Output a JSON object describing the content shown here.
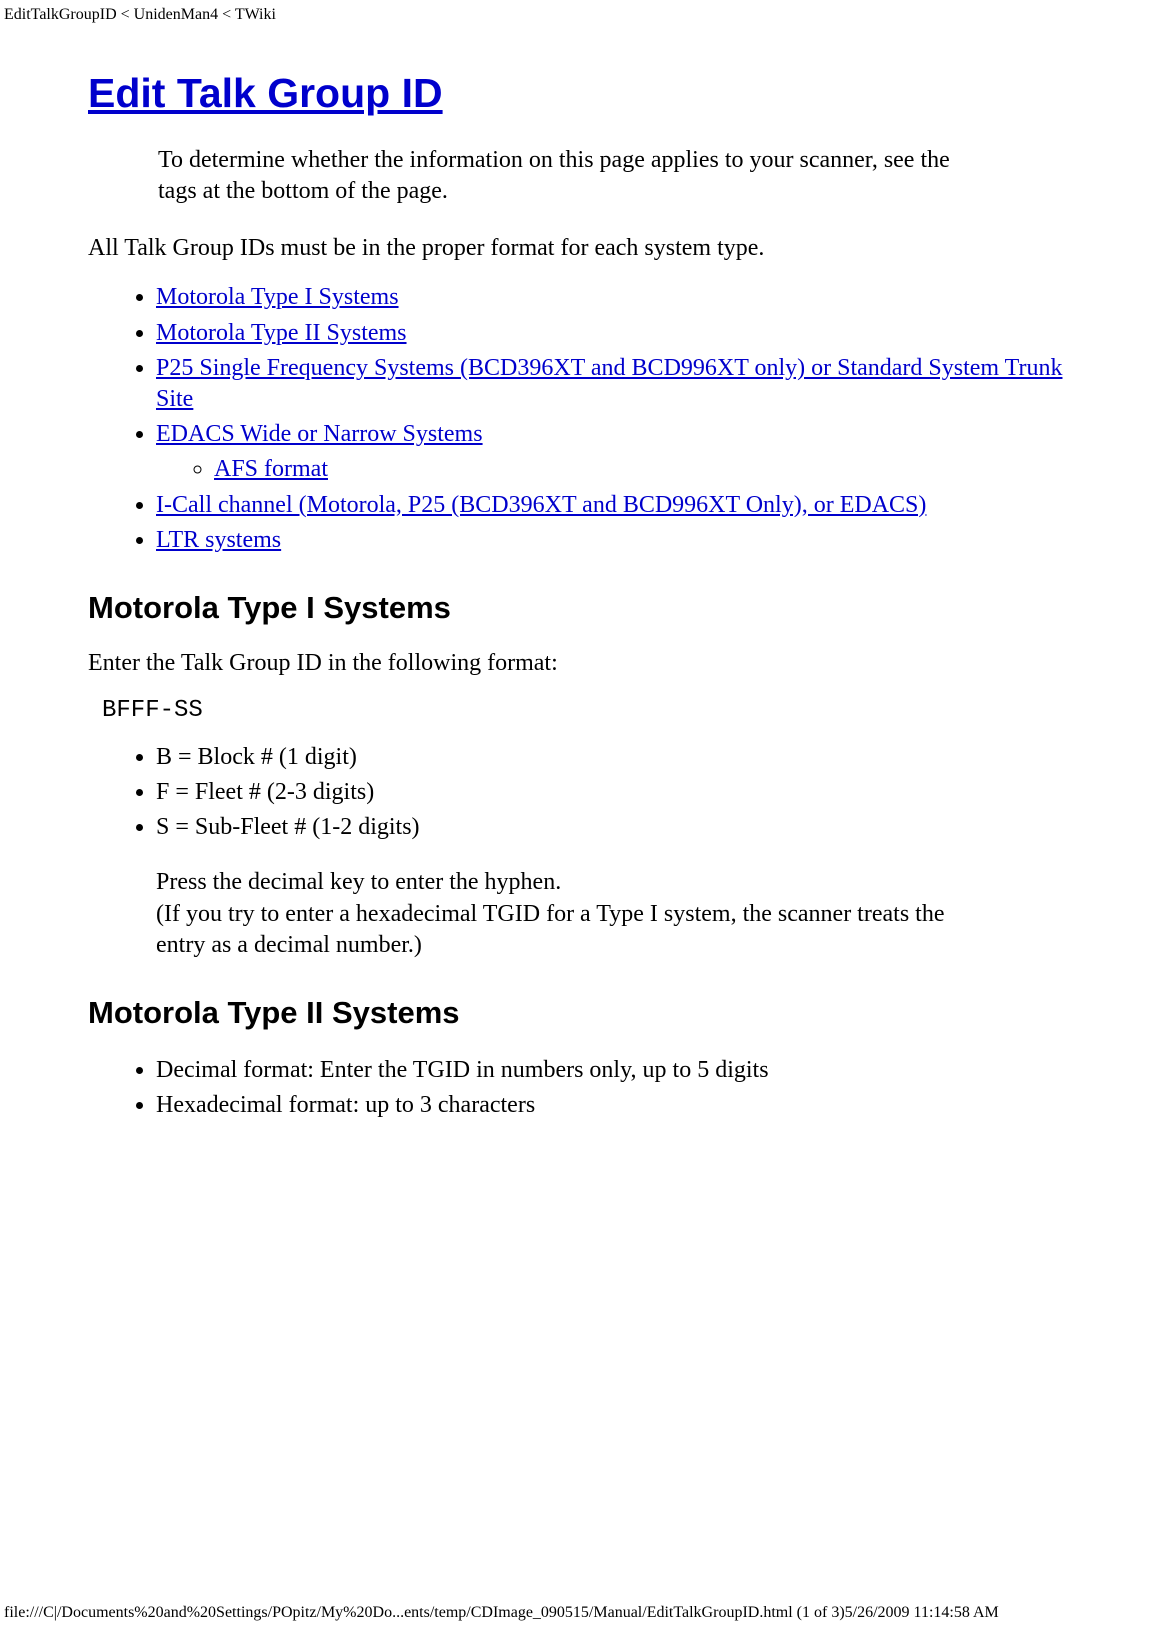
{
  "header": {
    "path": "EditTalkGroupID < UnidenMan4 < TWiki"
  },
  "title": "Edit Talk Group ID",
  "note": "To determine whether the information on this page applies to your scanner, see the tags at the bottom of the page.",
  "intro": "All Talk Group IDs must be in the proper format for each system type.",
  "toc": {
    "items": [
      "Motorola Type I Systems",
      "Motorola Type II Systems",
      "P25 Single Frequency Systems (BCD396XT and BCD996XT only) or Standard System Trunk Site",
      "EDACS Wide or Narrow Systems",
      "I-Call channel (Motorola, P25 (BCD396XT and BCD996XT Only), or EDACS)",
      "LTR systems"
    ],
    "sub_edacs": "AFS format"
  },
  "sections": {
    "mot1": {
      "heading": "Motorola Type I Systems",
      "intro": "Enter the Talk Group ID in the following format:",
      "code": "BFFF-SS",
      "bullets": [
        "B = Block # (1 digit)",
        "F = Fleet # (2-3 digits)",
        "S = Sub-Fleet # (1-2 digits)"
      ],
      "note": "Press the decimal key to enter the hyphen.\n(If you try to enter a hexadecimal TGID for a Type I system, the scanner treats the entry as a decimal number.)"
    },
    "mot2": {
      "heading": "Motorola Type II Systems",
      "bullets": [
        "Decimal format: Enter the TGID in numbers only, up to 5 digits",
        "Hexadecimal format: up to 3 characters"
      ]
    }
  },
  "footer": {
    "path": "file:///C|/Documents%20and%20Settings/POpitz/My%20Do...ents/temp/CDImage_090515/Manual/EditTalkGroupID.html (1 of 3)5/26/2009 11:14:58 AM"
  }
}
